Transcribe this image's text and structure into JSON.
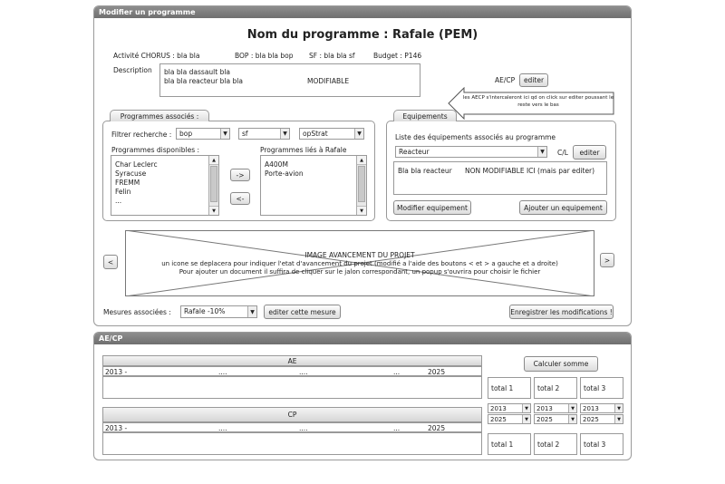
{
  "top_panel": {
    "header": "Modifier un programme",
    "title": "Nom du programme : Rafale (PEM)",
    "activite": "Activité CHORUS : bla bla",
    "bop": "BOP : bla bla bop",
    "sf": "SF   : bla bla sf",
    "budget": "Budget : P146",
    "description_label": "Description",
    "description_line1": "bla bla dassault bla",
    "description_line2": "bla bla reacteur bla bla",
    "description_modifiable": "MODIFIABLE",
    "aecp_label": "AE/CP",
    "aecp_button": "editer",
    "callout": "les AECP s'intercaleront ici qd on click sur editer poussant le reste vers le bas"
  },
  "programmes_associes": {
    "tab": "Programmes associés :",
    "filter_label": "Filtrer recherche :",
    "filter1": "bop",
    "filter2": "sf",
    "filter3": "opStrat",
    "dispo_label": "Programmes disponibles :",
    "dispo_items": [
      "Char Leclerc",
      "Syracuse",
      "FREMM",
      "Felin",
      "..."
    ],
    "lies_label": "Programmes liés à Rafale",
    "lies_items": [
      "A400M",
      "Porte-avion"
    ],
    "add_button": "->",
    "remove_button": "<-"
  },
  "equipements": {
    "tab": "Equipements",
    "list_label": "Liste des équipements associés au programme",
    "selected": "Reacteur",
    "cal_label": "C/L",
    "edit_button": "editer",
    "detail_name": "Bla bla reacteur",
    "detail_note": "NON MODIFIABLE ICI (mais par editer)",
    "modify_button": "Modifier equipement",
    "add_button": "Ajouter un equipement"
  },
  "avancement": {
    "prev_button": "<",
    "next_button": ">",
    "line1": "IMAGE AVANCEMENT DU PROJET",
    "line2": "un icone se deplacera pour indiquer l'etat d'avancement du projet (modifié a l'aide des boutons < et > a gauche et a droite)",
    "line3": "Pour ajouter un document il suffira de cliquer sur le jalon correspondant, un popup s'ouvrira pour choisir le fichier"
  },
  "mesures": {
    "label": "Mesures associées :",
    "selected": "Rafale -10%",
    "edit_button": "editer cette mesure",
    "save_button": "Enregistrer les modifications !"
  },
  "aecp_panel": {
    "header": "AE/CP",
    "ae_title": "AE",
    "cp_title": "CP",
    "axis": [
      "2013 -",
      "....",
      "....",
      "...",
      "2025"
    ],
    "calc_button": "Calculer somme",
    "totals": [
      "total 1",
      "total 2",
      "total 3"
    ],
    "year_start": "2013",
    "year_end": "2025"
  }
}
